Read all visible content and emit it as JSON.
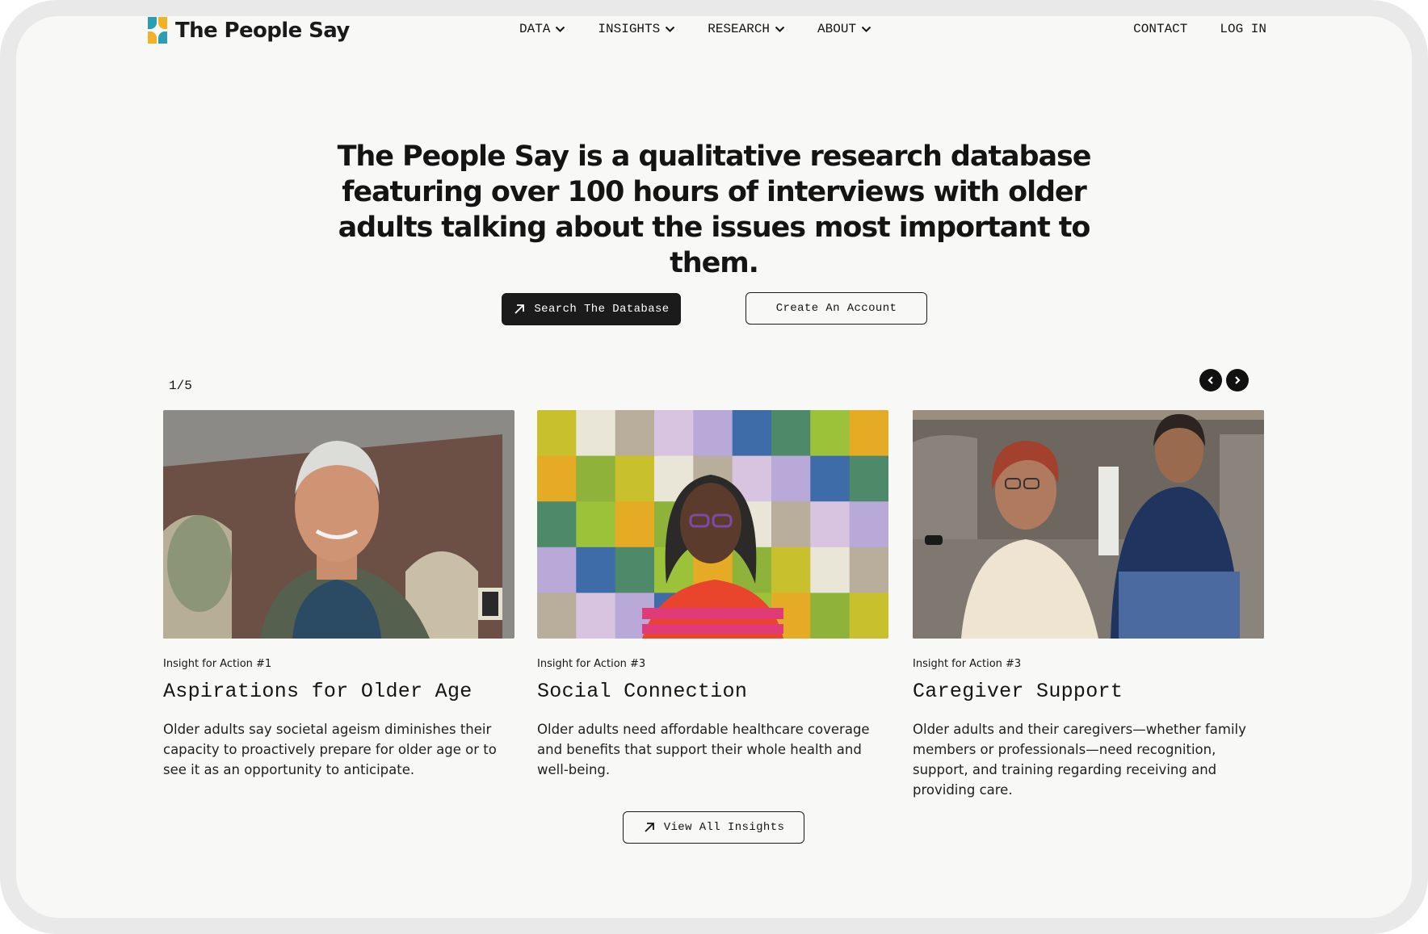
{
  "brand": {
    "name": "The People Say",
    "colors": {
      "logo_yellow": "#f0b323",
      "logo_teal": "#2a9fb3",
      "logo_green": "#6fb042",
      "ink": "#141414",
      "background": "#f8f8f7"
    }
  },
  "nav": {
    "items": [
      {
        "label": "DATA",
        "icon": "chevron-down-icon"
      },
      {
        "label": "INSIGHTS",
        "icon": "chevron-down-icon"
      },
      {
        "label": "RESEARCH",
        "icon": "chevron-down-icon"
      },
      {
        "label": "ABOUT",
        "icon": "chevron-down-icon"
      }
    ],
    "contact_label": "CONTACT",
    "login_label": "LOG IN"
  },
  "hero": {
    "title": "The People Say is a qualitative research database featuring over 100 hours of interviews with older adults talking about the issues most important to them.",
    "primary_button": "Search The Database",
    "secondary_button": "Create An Account"
  },
  "carousel": {
    "counter": "1/5",
    "prev_icon": "chevron-left-icon",
    "next_icon": "chevron-right-icon",
    "cards": [
      {
        "kicker": "Insight for Action #1",
        "title": "Aspirations for Older Age",
        "description": "Older adults say societal ageism diminishes  their capacity to proactively prepare for older age or to see it as an opportunity to anticipate."
      },
      {
        "kicker": "Insight for Action #3",
        "title": "Social Connection",
        "description": "Older adults need affordable healthcare coverage and benefits that support their whole health and well-being."
      },
      {
        "kicker": "Insight for Action #3",
        "title": "Caregiver Support",
        "description": "Older adults and their caregivers—whether family members or professionals—need recognition, support, and training regarding receiving and providing care."
      }
    ],
    "view_all_button": "View All Insights"
  }
}
